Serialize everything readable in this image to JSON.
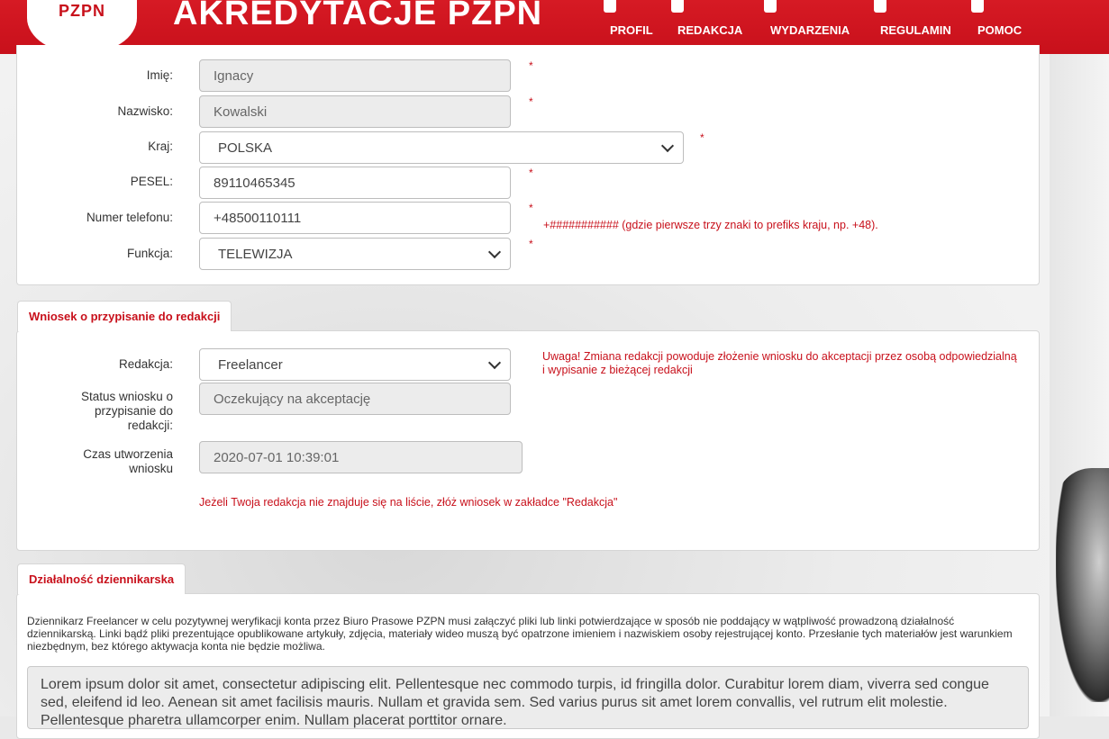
{
  "header": {
    "logo": "PZPN",
    "title": "AKREDYTACJE PZPN",
    "nav": [
      {
        "label": "PROFIL",
        "icon": "profile-icon"
      },
      {
        "label": "REDAKCJA",
        "icon": "newsroom-icon"
      },
      {
        "label": "WYDARZENIA",
        "icon": "events-icon"
      },
      {
        "label": "REGULAMIN",
        "icon": "rules-icon"
      },
      {
        "label": "POMOC",
        "icon": "help-icon"
      }
    ]
  },
  "personal": {
    "imie": {
      "label": "Imię:",
      "value": "Ignacy"
    },
    "nazwisko": {
      "label": "Nazwisko:",
      "value": "Kowalski"
    },
    "kraj": {
      "label": "Kraj:",
      "value": "POLSKA"
    },
    "pesel": {
      "label": "PESEL:",
      "value": "89110465345"
    },
    "telefon": {
      "label": "Numer telefonu:",
      "value": "+48500110111",
      "hint": "+########### (gdzie pierwsze trzy znaki to prefiks kraju, np. +48)."
    },
    "funkcja": {
      "label": "Funkcja:",
      "value": "TELEWIZJA"
    },
    "required_mark": "*"
  },
  "assignment": {
    "tab": "Wniosek o przypisanie do redakcji",
    "redakcja": {
      "label": "Redakcja:",
      "value": "Freelancer"
    },
    "warning": "Uwaga! Zmiana redakcji powoduje złożenie wniosku do akceptacji przez osobą odpowiedzialną i wypisanie z bieżącej redakcji",
    "status": {
      "label": "Status wniosku o przypisanie do redakcji:",
      "value": "Oczekujący na akceptację"
    },
    "czas": {
      "label": "Czas utworzenia wniosku",
      "value": "2020-07-01 10:39:01"
    },
    "note": "Jeżeli Twoja redakcja nie znajduje się na liście, złóż wniosek w zakładce \"Redakcja\""
  },
  "journalism": {
    "tab": "Działalność dziennikarska",
    "description": "Dziennikarz Freelancer w celu pozytywnej weryfikacji konta przez Biuro Prasowe PZPN musi załączyć pliki lub linki potwierdzające w sposób nie poddający w wątpliwość prowadzoną działalność dziennikarską. Linki bądź pliki prezentujące opublikowane artykuły, zdjęcia, materiały wideo muszą być opatrzone imieniem i nazwiskiem osoby rejestrującej konto. Przesłanie tych materiałów jest warunkiem niezbędnym, bez którego aktywacja konta nie będzie możliwa.",
    "text": "Lorem ipsum dolor sit amet, consectetur adipiscing elit. Pellentesque nec commodo turpis, id fringilla dolor. Curabitur lorem diam, viverra sed congue sed, eleifend id leo. Aenean sit amet facilisis mauris. Nullam et gravida sem. Sed varius purus sit amet lorem convallis, vel rutrum elit molestie. Pellentesque pharetra ullamcorper enim. Nullam placerat porttitor ornare."
  },
  "colors": {
    "brand": "#c8101b"
  }
}
